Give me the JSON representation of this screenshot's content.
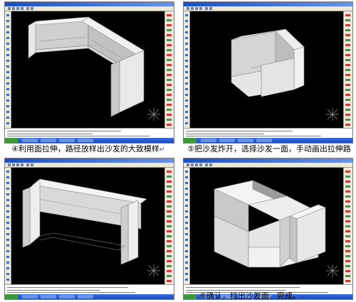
{
  "panels": [
    {
      "caption": "④利用面拉伸，路径放样出沙发的大致模样",
      "pilcrow": "↵"
    },
    {
      "caption": "⑤把沙发炸开，选择沙发一面，手动画出拉伸路",
      "pilcrow": ""
    },
    {
      "caption": "",
      "pilcrow": ""
    },
    {
      "caption": "⑥确认，拉出沙发面，完成。",
      "pilcrow": "↵"
    }
  ],
  "colors": {
    "viewport": "#000000",
    "shape_light": "#f2f2f2",
    "shape_mid": "#d8d8d8",
    "shape_dark": "#b4b4b4",
    "edge": "#7a7a7a"
  },
  "icons": [
    "ucs-axis-icon"
  ]
}
